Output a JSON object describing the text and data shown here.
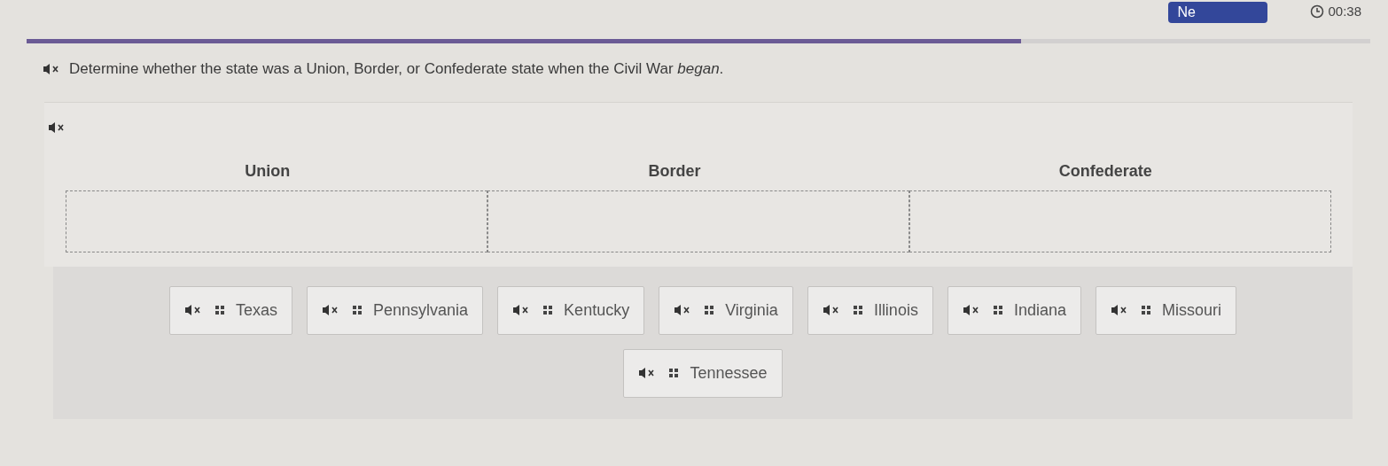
{
  "header": {
    "next_button": "Ne",
    "timer": "00:38",
    "progress": {
      "level": 0.74
    }
  },
  "question": "Determine whether the state was a Union, Border, or Confederate state when the Civil War *began*.",
  "categories": [
    {
      "label": "Union"
    },
    {
      "label": "Border"
    },
    {
      "label": "Confederate"
    }
  ],
  "tiles": [
    {
      "label": "Texas"
    },
    {
      "label": "Pennsylvania"
    },
    {
      "label": "Kentucky"
    },
    {
      "label": "Virginia"
    },
    {
      "label": "Illinois"
    },
    {
      "label": "Indiana"
    },
    {
      "label": "Missouri"
    },
    {
      "label": "Tennessee"
    }
  ]
}
